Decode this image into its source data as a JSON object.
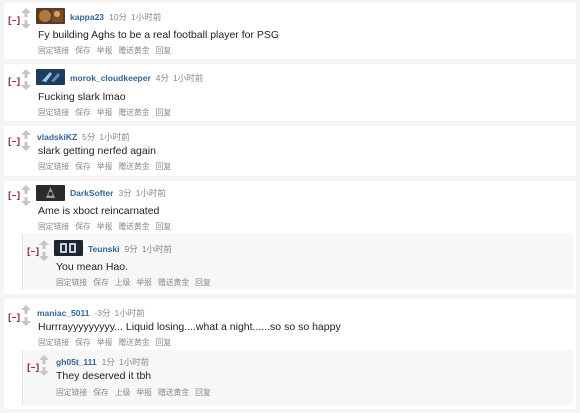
{
  "ui": {
    "collapse_label": "[–]",
    "colors": {
      "author": "#336699",
      "collapse": "#8a1b1b",
      "meta": "#888888",
      "body": "#222222"
    },
    "icons": {
      "upvote": "up-arrow-icon",
      "downvote": "down-arrow-icon"
    }
  },
  "comments": [
    {
      "author": "kappa23",
      "score": "10分",
      "time": "1小时前",
      "body": "Fy building Aghs to be a real football player for PSG",
      "buttons": [
        "固定链接",
        "保存",
        "举报",
        "赠送黄金",
        "回复"
      ]
    },
    {
      "author": "morok_cloudkeeper",
      "score": "4分",
      "time": "1小时前",
      "body": "Fucking slark lmao",
      "buttons": [
        "固定链接",
        "保存",
        "举报",
        "赠送黄金",
        "回复"
      ]
    },
    {
      "author": "vladskiKZ",
      "score": "5分",
      "time": "1小时前",
      "body": "slark getting nerfed again",
      "buttons": [
        "固定链接",
        "保存",
        "举报",
        "赠送黄金",
        "回复"
      ]
    },
    {
      "author": "DarkSofter",
      "score": "3分",
      "time": "1小时前",
      "body": "Ame is xboct reincarnated",
      "buttons": [
        "固定链接",
        "保存",
        "举报",
        "赠送黄金",
        "回复"
      ],
      "reply": {
        "author": "Teunski",
        "score": "9分",
        "time": "1小时前",
        "body": "You mean Hao.",
        "buttons": [
          "固定链接",
          "保存",
          "上级",
          "举报",
          "赠送黄金",
          "回复"
        ]
      }
    },
    {
      "author": "maniac_5011",
      "score": "-3分",
      "time": "1小时前",
      "body": "Hurrrayyyyyyyyy... Liquid losing....what a night......so so so happy",
      "buttons": [
        "固定链接",
        "保存",
        "举报",
        "赠送黄金",
        "回复"
      ],
      "reply": {
        "author": "gh05t_111",
        "score": "1分",
        "time": "1小时前",
        "body": "They deserved it tbh",
        "buttons": [
          "固定链接",
          "保存",
          "上级",
          "举报",
          "赠送黄金",
          "回复"
        ]
      }
    }
  ]
}
